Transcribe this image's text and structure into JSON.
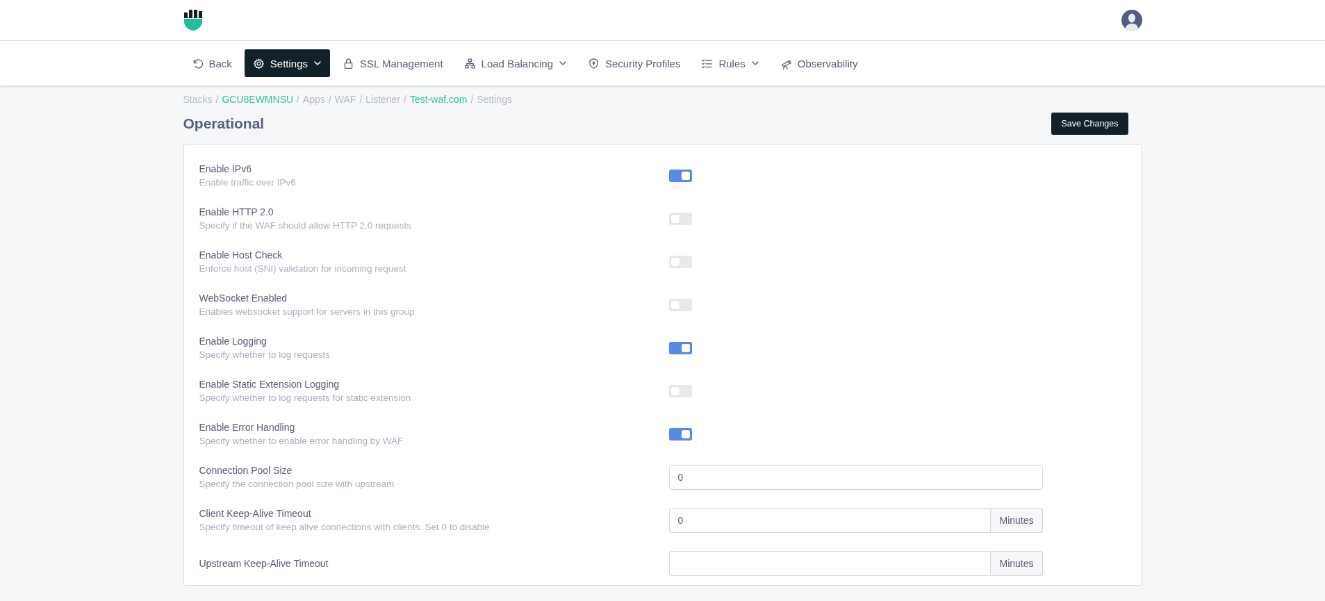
{
  "nav": [
    {
      "label": "Back",
      "selected": false,
      "menu": false
    },
    {
      "label": "Settings",
      "selected": true,
      "menu": true
    },
    {
      "label": "SSL Management",
      "selected": false,
      "menu": false
    },
    {
      "label": "Load Balancing",
      "selected": false,
      "menu": true
    },
    {
      "label": "Security Profiles",
      "selected": false,
      "menu": false
    },
    {
      "label": "Rules",
      "selected": false,
      "menu": true
    },
    {
      "label": "Observability",
      "selected": false,
      "menu": false
    }
  ],
  "breadcrumb": [
    {
      "kind": "text",
      "label": "Stacks"
    },
    {
      "kind": "separator",
      "label": "/"
    },
    {
      "kind": "link",
      "label": "GCU8EWMNSU"
    },
    {
      "kind": "separator",
      "label": "/"
    },
    {
      "kind": "text",
      "label": "Apps"
    },
    {
      "kind": "separator",
      "label": "/"
    },
    {
      "kind": "text",
      "label": "WAF"
    },
    {
      "kind": "separator",
      "label": "/"
    },
    {
      "kind": "text",
      "label": "Listener"
    },
    {
      "kind": "separator",
      "label": "/"
    },
    {
      "kind": "link",
      "label": "Test-waf.com"
    },
    {
      "kind": "separator",
      "label": "/"
    },
    {
      "kind": "text",
      "label": "Settings"
    }
  ],
  "page_title": "Operational",
  "save_button": "Save Changes",
  "settings": [
    {
      "kind": "toggle",
      "label": "Enable IPv6",
      "description": "Enable traffic over IPv6",
      "on": true
    },
    {
      "kind": "toggle",
      "label": "Enable HTTP 2.0",
      "description": "Specify if the WAF should allow HTTP 2.0 requests",
      "on": false
    },
    {
      "kind": "toggle",
      "label": "Enable Host Check",
      "description": "Enforce host (SNI) validation for incoming request",
      "on": false
    },
    {
      "kind": "toggle",
      "label": "WebSocket Enabled",
      "description": "Enables websocket support for servers in this group",
      "on": false
    },
    {
      "kind": "toggle",
      "label": "Enable Logging",
      "description": "Specify whether to log requests",
      "on": true
    },
    {
      "kind": "toggle",
      "label": "Enable Static Extension Logging",
      "description": "Specify whether to log requests for static extension",
      "on": false
    },
    {
      "kind": "toggle",
      "label": "Enable Error Handling",
      "description": "Specify whether to enable error handling by WAF",
      "on": true
    },
    {
      "kind": "input",
      "label": "Connection Pool Size",
      "description": "Specify the connection pool size with upstream",
      "value": "0"
    },
    {
      "kind": "input",
      "label": "Client Keep-Alive Timeout",
      "description": "Specify timeout of keep alive connections with clients. Set 0 to disable",
      "value": "0",
      "unit": "Minutes"
    },
    {
      "kind": "input",
      "label": "Upstream Keep-Alive Timeout",
      "unit": "Minutes"
    }
  ]
}
